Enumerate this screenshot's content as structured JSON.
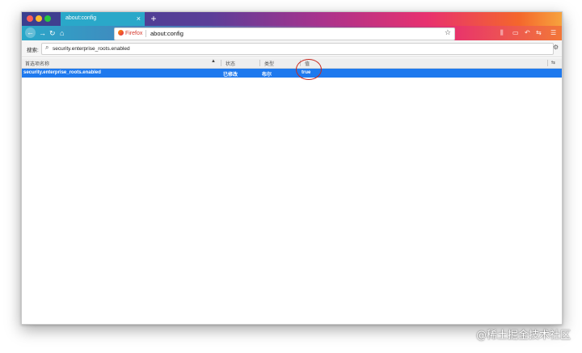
{
  "tab": {
    "title": "about:config",
    "close": "×",
    "new": "+"
  },
  "nav": {
    "back": "←",
    "forward": "→",
    "reload": "↻",
    "home": "⌂"
  },
  "urlbar": {
    "brand": "Firefox",
    "url": "about:config",
    "star": "☆"
  },
  "toolbar": {
    "library": "⫼",
    "sidebar": "▭",
    "undo": "↶",
    "sync": "⇆",
    "menu": "☰"
  },
  "search": {
    "label": "搜索:",
    "icon": "⌕",
    "value": "security.enterprise_roots.enabled",
    "clear": "⚙"
  },
  "columns": {
    "name": "首选项名称",
    "sort": "▲",
    "status": "状态",
    "type": "类型",
    "value": "值",
    "picker": "⇆"
  },
  "rows": [
    {
      "name": "security.enterprise_roots.enabled",
      "status": "已修改",
      "type": "布尔",
      "value": "true"
    }
  ],
  "colors": {
    "selected_row": "#1e79ee",
    "highlight_ring": "#c8281e"
  },
  "watermark": "@稀土掘金技术社区"
}
